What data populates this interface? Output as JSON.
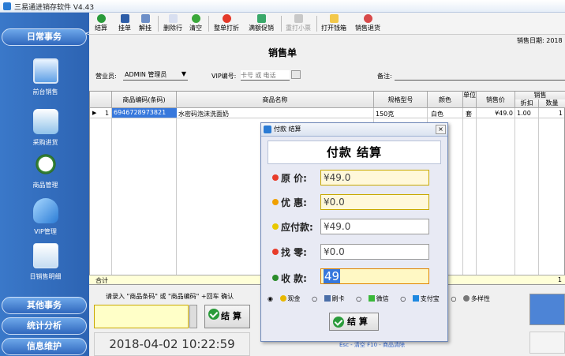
{
  "window": {
    "title": "三易通进销存软件 V4.43"
  },
  "sidebar": {
    "collapse": "<<",
    "groups": {
      "daily": "日常事务",
      "other": "其他事务",
      "stats": "统计分析",
      "info": "信息维护"
    },
    "items": [
      "前台销售",
      "采购进货",
      "商品管理",
      "VIP管理",
      "日销售明细"
    ]
  },
  "toolbar": {
    "buttons": [
      "结算",
      "挂单",
      "解挂",
      "删除行",
      "清空",
      "整单打折",
      "满额促销",
      "重打小票",
      "打开钱箱",
      "销售退货"
    ]
  },
  "header": {
    "sale_date_label": "销售日期:",
    "sale_date_value": "2018",
    "title": "销售单"
  },
  "form": {
    "salesperson_label": "营业员:",
    "salesperson_value": "ADMIN 管理员",
    "vip_label": "VIP编号:",
    "vip_placeholder": "卡号 或 电话",
    "note_label": "备注:"
  },
  "grid": {
    "columns": [
      "商品编码(条码)",
      "商品名称",
      "规格型号",
      "颜色",
      "单位",
      "销售价",
      "销售",
      "折扣",
      "数量"
    ],
    "rows": [
      {
        "index": "1",
        "code": "6946728973821",
        "name": "水密码泡沫洗面奶",
        "spec": "150克",
        "color": "白色",
        "unit": "套",
        "price": "¥49.0",
        "discount": "1.00",
        "qty": "1"
      }
    ],
    "total_label": "合计",
    "total_qty": "1"
  },
  "bottom": {
    "hint": "请录入 \"商品条码\" 或 \"商品编码\"  +回车 确认",
    "checkout": "结 算",
    "clock": "2018-04-02 10:22:59",
    "shortcut_hint": "Esc - 清空      F10 - 商品清除"
  },
  "dialog": {
    "title": "付款 结算",
    "close": "×",
    "heading": "付款 结算",
    "fields": [
      {
        "label": "原  价:",
        "value": "¥49.0",
        "color": "#e83c2a"
      },
      {
        "label": "优  惠:",
        "value": "¥0.0",
        "color": "#f0a000"
      },
      {
        "label": "应付款:",
        "value": "¥49.0",
        "color": "#e8c800"
      },
      {
        "label": "找  零:",
        "value": "¥0.0",
        "color": "#e83c2a"
      },
      {
        "label": "收  款:",
        "value": "49",
        "color": "#2a8c2a"
      }
    ],
    "pay_methods": [
      "现金",
      "刷卡",
      "微信",
      "支付宝",
      "多样性"
    ],
    "button": "结 算"
  }
}
